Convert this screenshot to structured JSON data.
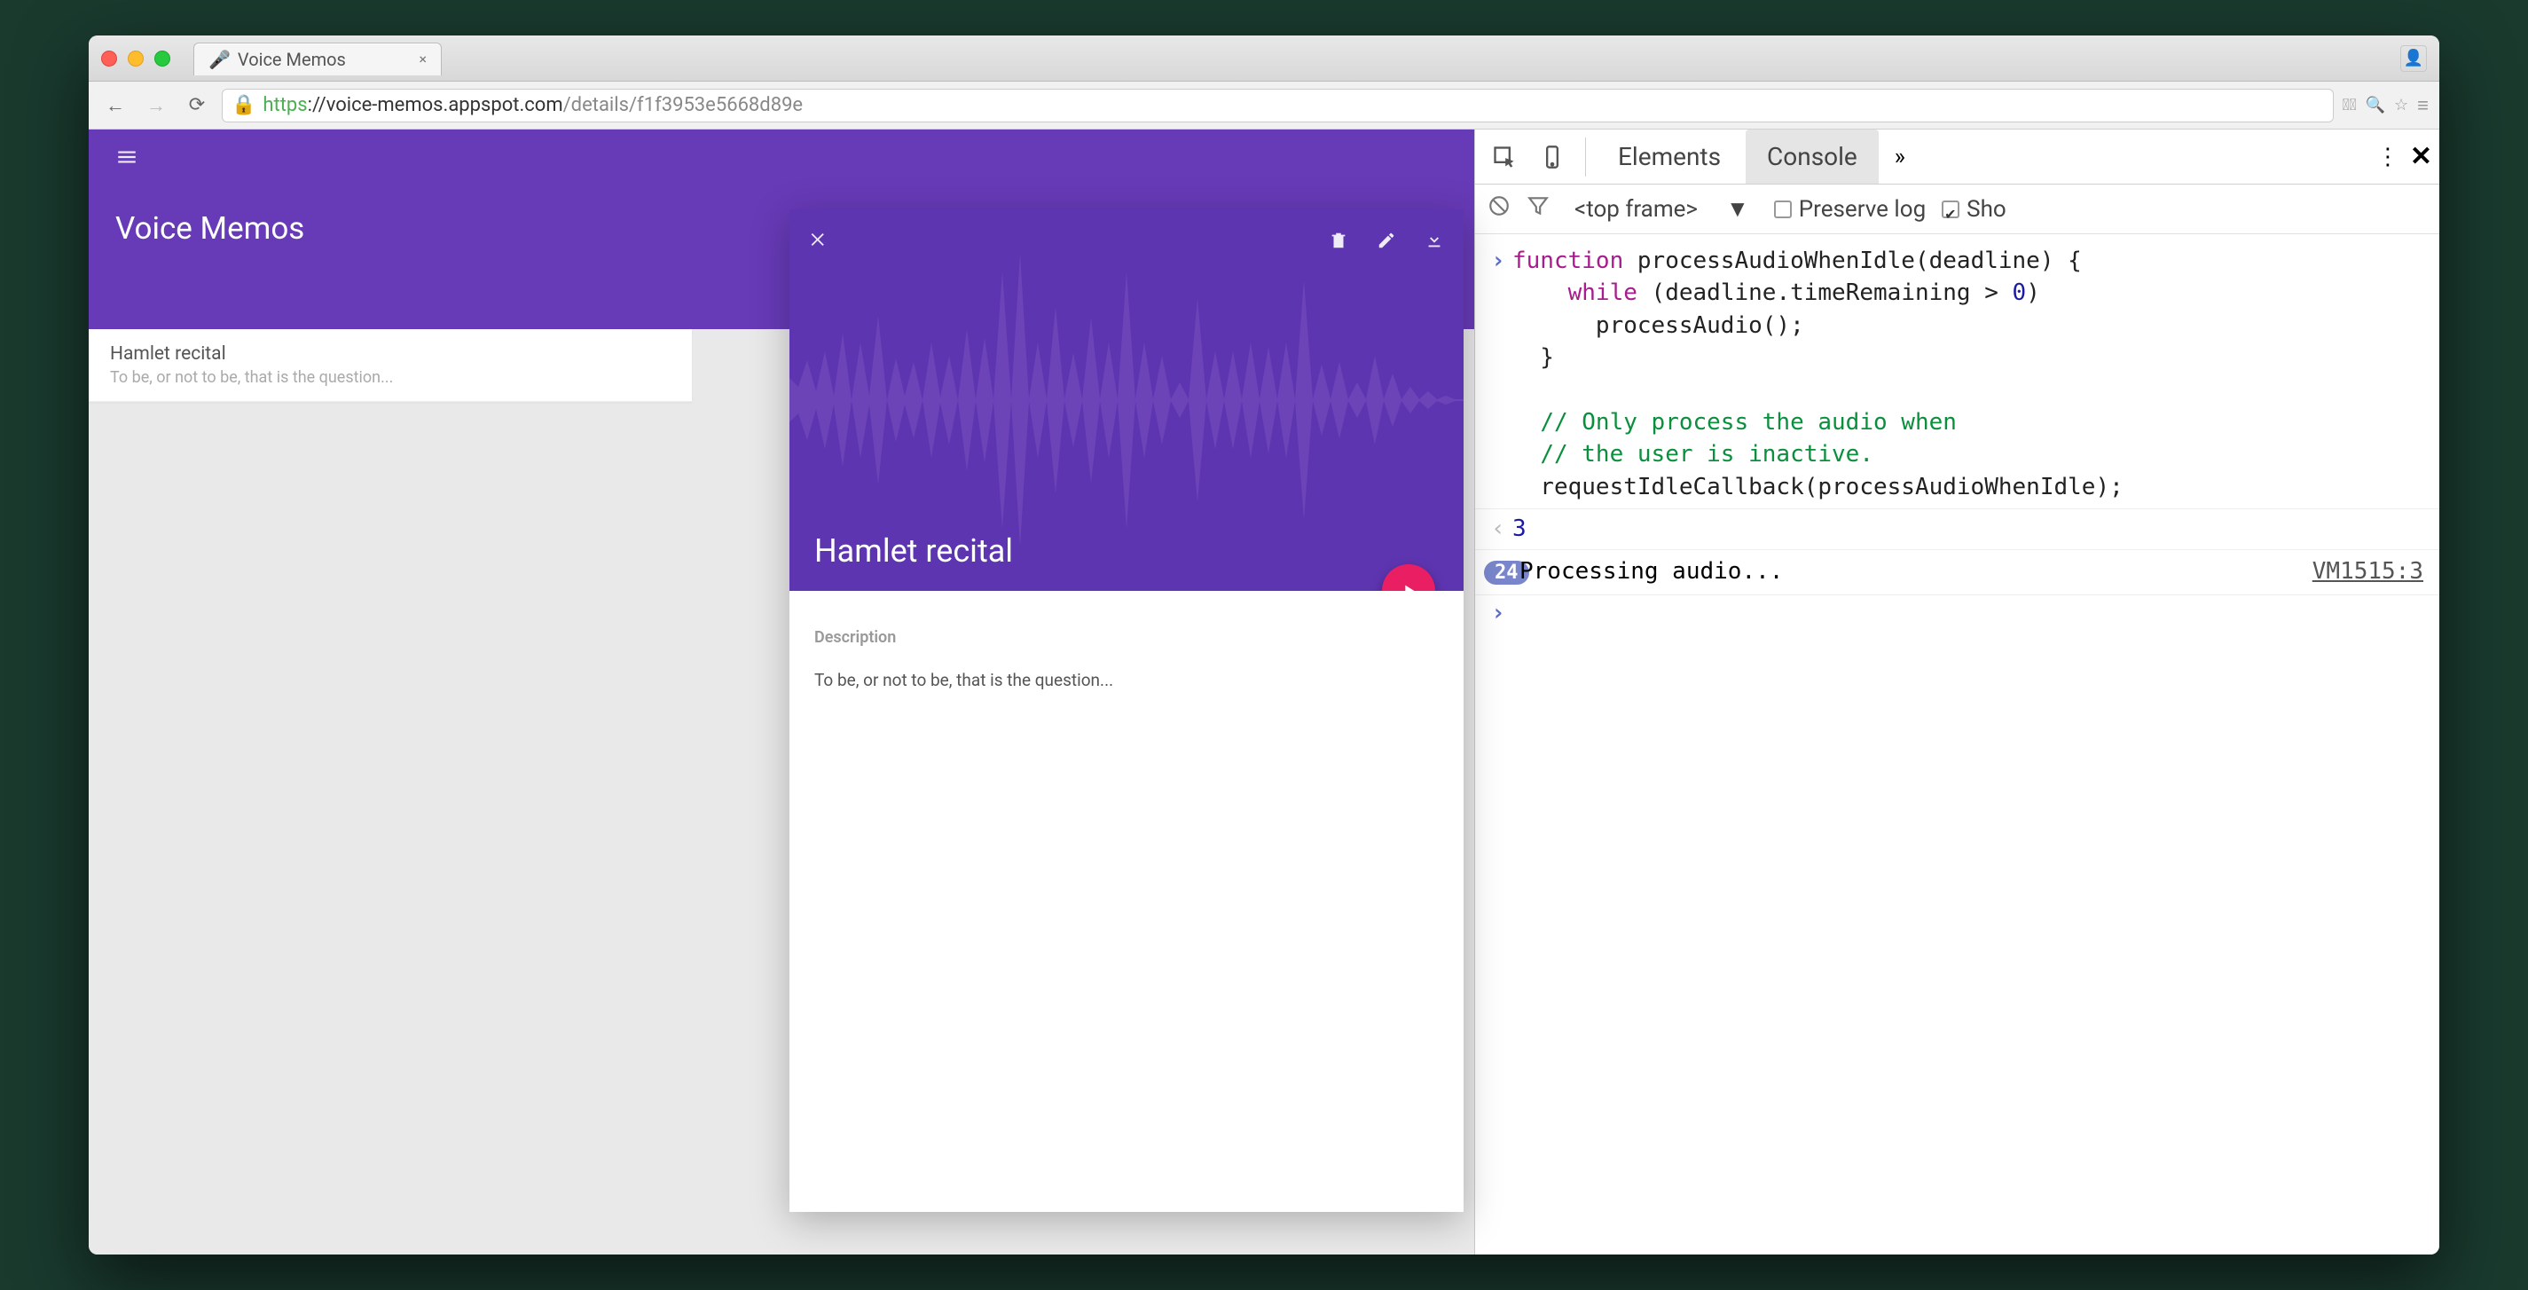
{
  "browser": {
    "tab_title": "Voice Memos",
    "favicon": "mic-icon",
    "url_scheme": "https",
    "url_host": "://voice-memos.appspot.com",
    "url_path": "/details/f1f3953e5668d89e"
  },
  "app": {
    "title": "Voice Memos",
    "list_item": {
      "title": "Hamlet recital",
      "subtitle": "To be, or not to be, that is the question..."
    },
    "detail": {
      "title": "Hamlet recital",
      "description_label": "Description",
      "description_text": "To be, or not to be, that is the question..."
    }
  },
  "devtools": {
    "tabs": [
      "Elements",
      "Console"
    ],
    "active_tab": "Console",
    "frame_selector": "<top frame>",
    "preserve_log_label": "Preserve log",
    "show_label": "Sho",
    "code_block": "function processAudioWhenIdle(deadline) {\n    while (deadline.timeRemaining > 0)\n      processAudio();\n  }\n\n  // Only process the audio when\n  // the user is inactive.\n  requestIdleCallback(processAudioWhenIdle);",
    "result_value": "3",
    "log_count": "24",
    "log_message": "Processing audio...",
    "log_source": "VM1515:3"
  }
}
